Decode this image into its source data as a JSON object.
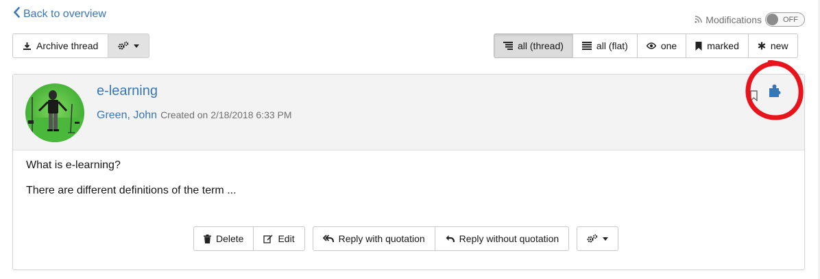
{
  "nav": {
    "back_label": "Back to overview"
  },
  "modifications": {
    "label": "Modifications",
    "toggle_state": "OFF"
  },
  "toolbar": {
    "archive_label": "Archive thread"
  },
  "view_modes": [
    {
      "label": "all (thread)",
      "icon": "tree-list-icon",
      "active": true
    },
    {
      "label": "all (flat)",
      "icon": "list-icon",
      "active": false
    },
    {
      "label": "one",
      "icon": "eye-icon",
      "active": false
    },
    {
      "label": "marked",
      "icon": "bookmark-icon",
      "active": false
    },
    {
      "label": "new",
      "icon": "asterisk-icon",
      "active": false
    }
  ],
  "post": {
    "title": "e-learning",
    "author": "Green, John",
    "created": "Created on 2/18/2018 6:33 PM",
    "body": [
      "What is e-learning?",
      "There are different definitions of the term ..."
    ],
    "actions": {
      "delete": "Delete",
      "edit": "Edit",
      "reply_quote": "Reply with quotation",
      "reply_no_quote": "Reply without quotation"
    }
  },
  "colors": {
    "link": "#3876b5",
    "highlight": "#e8141c",
    "header_bg": "#f3f3f3"
  }
}
